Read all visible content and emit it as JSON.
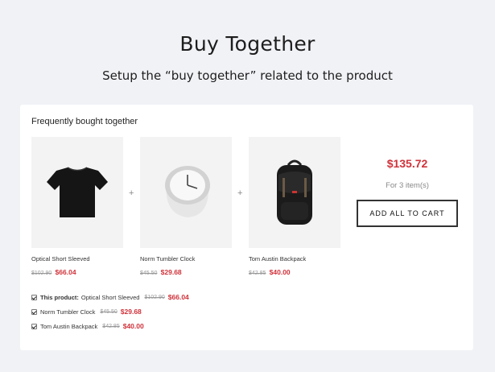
{
  "hero": {
    "title": "Buy Together",
    "subtitle": "Setup the “buy together” related to the product"
  },
  "card": {
    "title": "Frequently bought together",
    "products": [
      {
        "name": "Optical Short Sleeved",
        "old_price": "$102.90",
        "new_price": "$66.04",
        "image": "t-shirt-icon"
      },
      {
        "name": "Norm Tumbler Clock",
        "old_price": "$45.50",
        "new_price": "$29.68",
        "image": "clock-icon"
      },
      {
        "name": "Tom Austin Backpack",
        "old_price": "$42.85",
        "new_price": "$40.00",
        "image": "backpack-icon"
      }
    ],
    "plus_sign": "+",
    "total": "$135.72",
    "items_label": "For 3 item(s)",
    "add_button": "ADD ALL TO CART",
    "checklist": {
      "this_product_label": "This product:",
      "rows": [
        {
          "name": "Optical Short Sleeved",
          "old_price": "$102.90",
          "new_price": "$66.04",
          "checked": true
        },
        {
          "name": "Norm Tumbler Clock",
          "old_price": "$45.50",
          "new_price": "$29.68",
          "checked": true
        },
        {
          "name": "Tom Austin Backpack",
          "old_price": "$42.85",
          "new_price": "$40.00",
          "checked": true
        }
      ]
    }
  },
  "colors": {
    "background": "#f1f2f6",
    "price_red": "#d0323a",
    "button_border": "#333333"
  }
}
